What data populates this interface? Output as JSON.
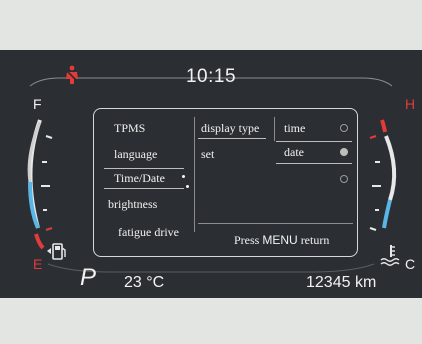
{
  "status_bar": {
    "time": "10:15"
  },
  "fuel_gauge": {
    "full_label": "F",
    "empty_label": "E"
  },
  "temp_gauge": {
    "hot_label": "H",
    "cold_label": "C"
  },
  "menu": {
    "main_items": [
      {
        "label": "TPMS",
        "selected": false
      },
      {
        "label": "language",
        "selected": false
      },
      {
        "label": "Time/Date",
        "selected": true
      },
      {
        "label": "brightness",
        "selected": false
      },
      {
        "label": "fatigue drive",
        "selected": false
      }
    ],
    "sub_items": [
      {
        "label": "display type",
        "selected": true
      },
      {
        "label": "set",
        "selected": false
      }
    ],
    "options": [
      {
        "label": "time",
        "checked": false
      },
      {
        "label": "date",
        "checked": true
      },
      {
        "label": "",
        "checked": false
      }
    ],
    "hint_prefix": "Press",
    "hint_key": "MENU",
    "hint_suffix": "return"
  },
  "bottom_bar": {
    "gear": "P",
    "outside_temp": "23 °C",
    "odometer": "12345 km"
  },
  "colors": {
    "background": "#2b2f33",
    "warning_red": "#e23b3b",
    "gauge_blue": "#5bb6e8",
    "text": "#f2f2f2"
  },
  "icons": [
    "seatbelt-warning-icon",
    "fuel-pump-icon",
    "coolant-temperature-icon"
  ]
}
